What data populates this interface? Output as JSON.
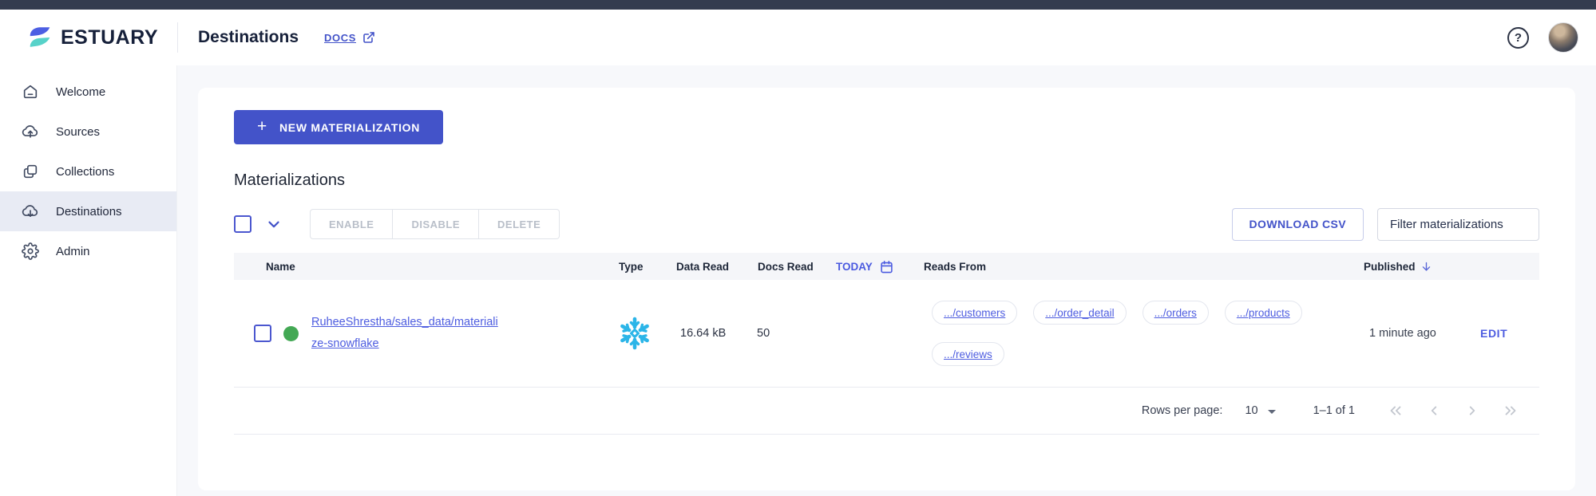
{
  "header": {
    "brand": "ESTUARY",
    "page_title": "Destinations",
    "docs_label": "DOCS",
    "help_glyph": "?"
  },
  "sidebar": {
    "items": [
      {
        "label": "Welcome",
        "icon": "home-icon",
        "active": false
      },
      {
        "label": "Sources",
        "icon": "cloud-upload-icon",
        "active": false
      },
      {
        "label": "Collections",
        "icon": "collections-icon",
        "active": false
      },
      {
        "label": "Destinations",
        "icon": "cloud-download-icon",
        "active": true
      },
      {
        "label": "Admin",
        "icon": "gear-icon",
        "active": false
      }
    ]
  },
  "main": {
    "new_button_label": "NEW MATERIALIZATION",
    "new_button_plus": "+",
    "section_title": "Materializations",
    "bulk_actions": {
      "enable": "ENABLE",
      "disable": "DISABLE",
      "delete": "DELETE"
    },
    "download_csv_label": "DOWNLOAD CSV",
    "filter_placeholder": "Filter materializations",
    "table": {
      "columns": {
        "name": "Name",
        "type": "Type",
        "data_read": "Data Read",
        "docs_read": "Docs Read",
        "today": "TODAY",
        "reads_from": "Reads From",
        "published": "Published"
      },
      "rows": [
        {
          "name": "RuheeShrestha/sales_data/materialize-snowflake",
          "status": "green",
          "connector": "snowflake",
          "data_read": "16.64 kB",
          "docs_read": "50",
          "reads_from": [
            ".../customers",
            ".../order_detail",
            ".../orders",
            ".../products",
            ".../reviews"
          ],
          "published": "1 minute ago",
          "action": "EDIT"
        }
      ]
    },
    "pagination": {
      "rows_per_page_label": "Rows per page:",
      "rows_per_page_value": "10",
      "range_label": "1–1 of 1"
    }
  },
  "colors": {
    "accent": "#4353c9",
    "link": "#4d5ce0",
    "topbar": "#343c4f",
    "status_green": "#43a854",
    "snowflake_blue": "#2bb5e8",
    "header_bg": "#f5f6f9"
  }
}
